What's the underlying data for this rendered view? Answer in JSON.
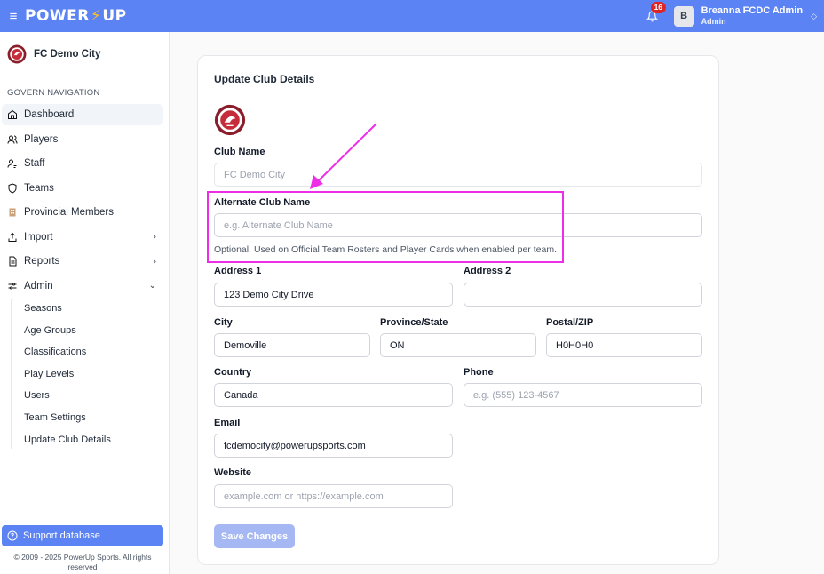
{
  "app": {
    "logo_left": "POWER",
    "logo_right": "UP",
    "notification_count": "16",
    "user_initial": "B",
    "user_name": "Breanna FCDC Admin",
    "user_role": "Admin"
  },
  "sidebar": {
    "club_name": "FC Demo City",
    "nav_heading": "GOVERN NAVIGATION",
    "items": [
      {
        "label": "Dashboard",
        "icon": "home-icon"
      },
      {
        "label": "Players",
        "icon": "users-icon"
      },
      {
        "label": "Staff",
        "icon": "user-tag-icon"
      },
      {
        "label": "Teams",
        "icon": "shield-icon"
      },
      {
        "label": "Provincial Members",
        "icon": "building-icon"
      },
      {
        "label": "Import",
        "icon": "upload-icon"
      },
      {
        "label": "Reports",
        "icon": "file-icon"
      },
      {
        "label": "Admin",
        "icon": "sliders-icon"
      }
    ],
    "admin_sub": [
      "Seasons",
      "Age Groups",
      "Classifications",
      "Play Levels",
      "Users",
      "Team Settings",
      "Update Club Details"
    ],
    "support_label": "Support database",
    "copyright": "© 2009 - 2025 PowerUp Sports. All rights reserved"
  },
  "form": {
    "title": "Update Club Details",
    "club_name_label": "Club Name",
    "club_name_value": "FC Demo City",
    "alt_name_label": "Alternate Club Name",
    "alt_name_placeholder": "e.g. Alternate Club Name",
    "alt_name_help": "Optional. Used on Official Team Rosters and Player Cards when enabled per team.",
    "address1_label": "Address 1",
    "address1_value": "123 Demo City Drive",
    "address2_label": "Address 2",
    "address2_value": "",
    "city_label": "City",
    "city_value": "Demoville",
    "province_label": "Province/State",
    "province_value": "ON",
    "postal_label": "Postal/ZIP",
    "postal_value": "H0H0H0",
    "country_label": "Country",
    "country_value": "Canada",
    "phone_label": "Phone",
    "phone_placeholder": "e.g. (555) 123-4567",
    "email_label": "Email",
    "email_value": "fcdemocity@powerupsports.com",
    "website_label": "Website",
    "website_placeholder": "example.com or https://example.com",
    "save_label": "Save Changes"
  },
  "colors": {
    "brand": "#5b83f4",
    "annotation": "#ee2ee6"
  }
}
